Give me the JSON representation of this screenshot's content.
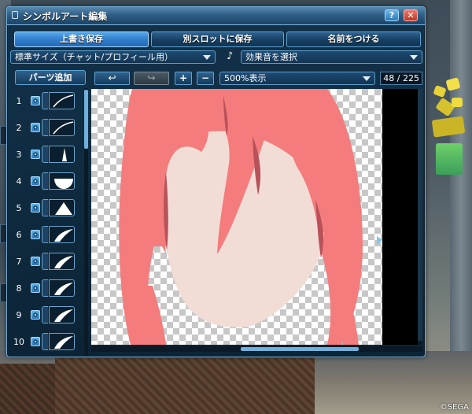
{
  "window": {
    "title": "シンボルアート編集",
    "help_label": "?",
    "close_label": "✕"
  },
  "toolbar_top": {
    "overwrite_save": "上書き保存",
    "save_to_slot": "別スロットに保存",
    "name_it": "名前をつける"
  },
  "size_select": {
    "value": "標準サイズ（チャット/プロフィール用）"
  },
  "sound_select": {
    "value": "効果音を選択",
    "icon": "music-note-icon"
  },
  "parts": {
    "add_label": "パーツ追加",
    "layers": [
      {
        "num": "1",
        "shape": "curve-thin"
      },
      {
        "num": "2",
        "shape": "curve-thin"
      },
      {
        "num": "3",
        "shape": "spike"
      },
      {
        "num": "4",
        "shape": "half-circle"
      },
      {
        "num": "5",
        "shape": "triangle"
      },
      {
        "num": "6",
        "shape": "curve-thick"
      },
      {
        "num": "7",
        "shape": "curve-thick"
      },
      {
        "num": "8",
        "shape": "curve-thick"
      },
      {
        "num": "9",
        "shape": "curve-thick"
      },
      {
        "num": "10",
        "shape": "curve-thick"
      }
    ]
  },
  "edit_tools": {
    "undo": "↩",
    "redo": "↪",
    "zoom_in": "+",
    "zoom_out": "−",
    "zoom_value": "500%表示",
    "layer_count": "48 / 225"
  },
  "colors": {
    "hair": "#f47c7c",
    "hair_shadow": "#b8525a",
    "skin": "#f2dcd6",
    "accent": "#56a6e8"
  },
  "footer": {
    "copyright": "©SEGA"
  }
}
